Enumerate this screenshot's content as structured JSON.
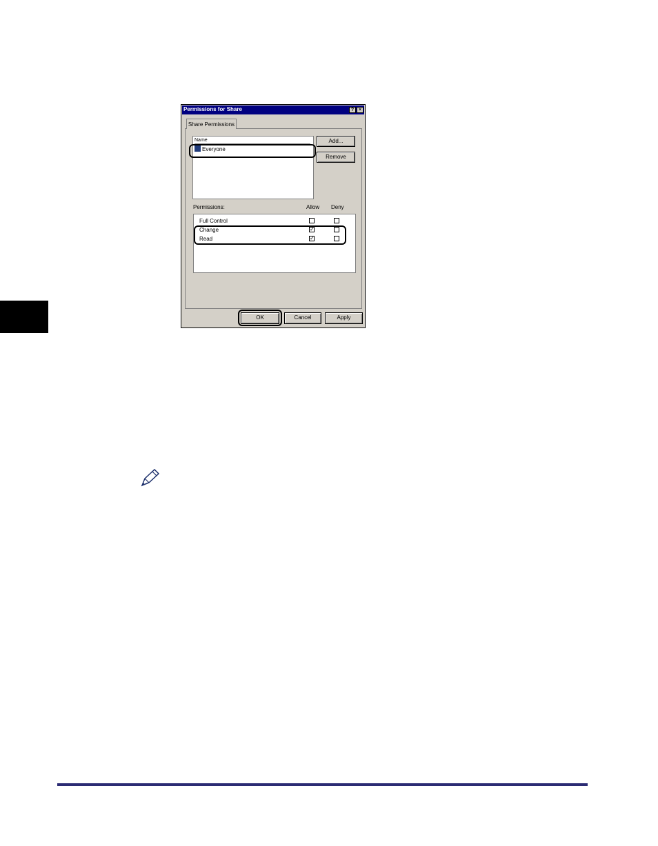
{
  "dialog": {
    "title": "Permissions for Share",
    "help_glyph": "?",
    "close_glyph": "×",
    "tab_label": "Share Permissions",
    "name_header": "Name",
    "names": [
      "Everyone"
    ],
    "add_label": "Add...",
    "remove_label": "Remove",
    "permissions_label": "Permissions:",
    "allow_header": "Allow",
    "deny_header": "Deny",
    "permissions": [
      {
        "name": "Full Control",
        "allow": false,
        "deny": false
      },
      {
        "name": "Change",
        "allow": true,
        "deny": false
      },
      {
        "name": "Read",
        "allow": true,
        "deny": false
      }
    ],
    "ok_label": "OK",
    "cancel_label": "Cancel",
    "apply_label": "Apply",
    "check_glyph": "✓"
  },
  "icons": {
    "note": "pencil-note-icon",
    "user": "user-group-icon"
  },
  "colors": {
    "titlebar": "#000080",
    "footer_rule": "#2b2b73"
  }
}
